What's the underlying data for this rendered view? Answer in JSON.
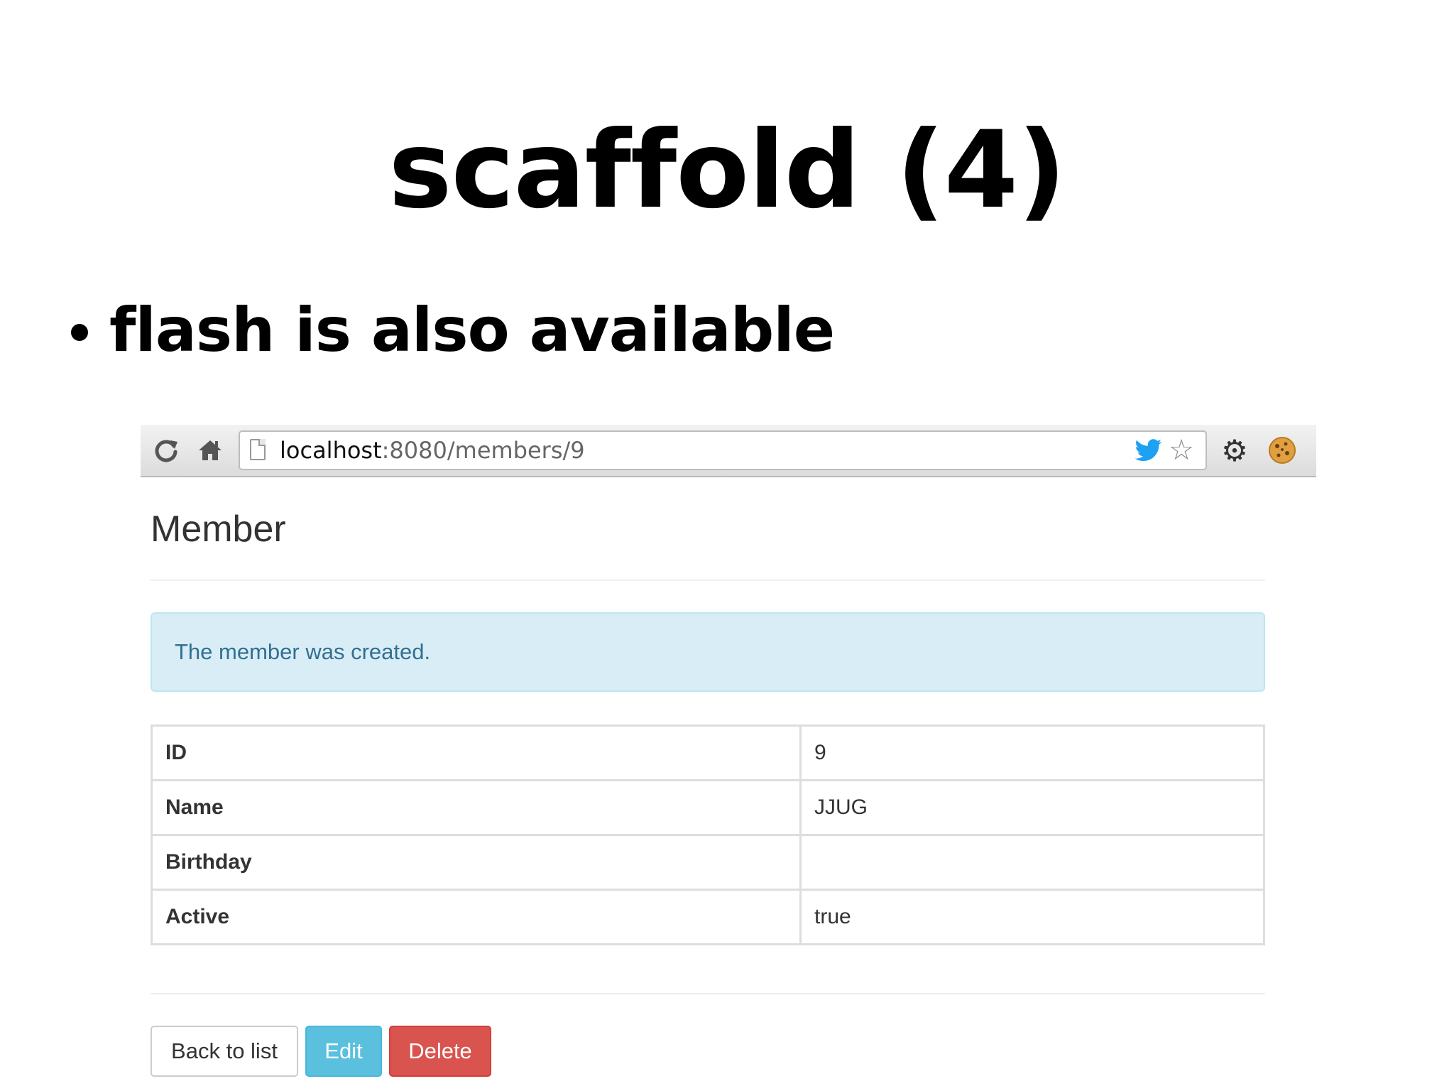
{
  "slide": {
    "title": "scaffold (4)",
    "bullet": "flash is also available"
  },
  "browser": {
    "url_host": "localhost",
    "url_rest": ":8080/members/9",
    "icons": [
      "reload-icon",
      "home-icon",
      "page-icon",
      "twitter-icon",
      "star-icon",
      "gear-icon",
      "cookie-icon"
    ],
    "colors": {
      "twitter": "#1da1f2",
      "cookie": "#e0a040"
    }
  },
  "page": {
    "heading": "Member",
    "flash_message": "The member was created.",
    "table": {
      "rows": [
        {
          "label": "ID",
          "value": "9"
        },
        {
          "label": "Name",
          "value": "JJUG"
        },
        {
          "label": "Birthday",
          "value": ""
        },
        {
          "label": "Active",
          "value": "true"
        }
      ]
    },
    "buttons": {
      "back": "Back to list",
      "edit": "Edit",
      "delete": "Delete"
    },
    "colors": {
      "alert_bg": "#d9edf7",
      "alert_text": "#31708f",
      "edit_btn": "#5bc0de",
      "delete_btn": "#d9534f"
    }
  }
}
